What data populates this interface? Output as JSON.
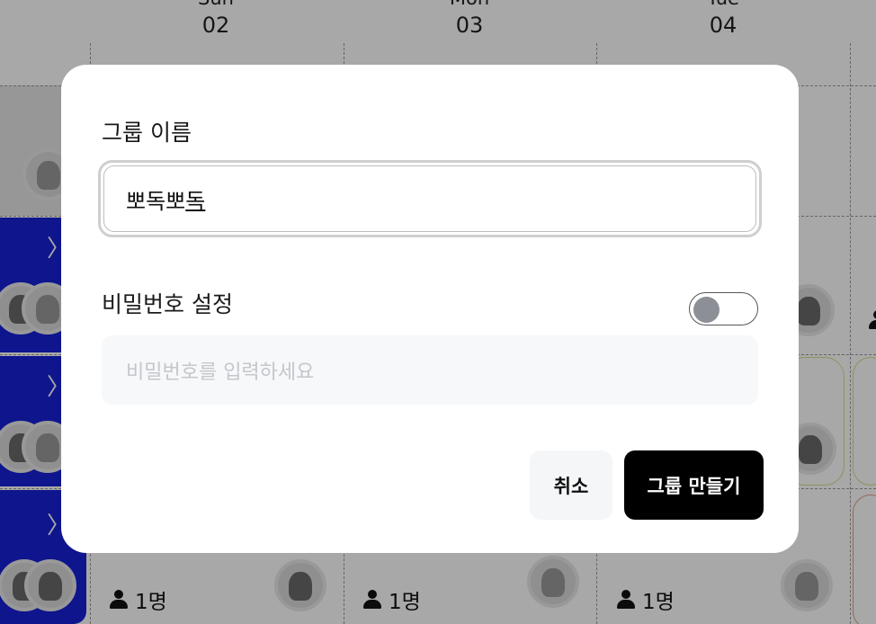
{
  "calendar": {
    "days": [
      {
        "dow": "Sun",
        "num": "02"
      },
      {
        "dow": "Mon",
        "num": "03"
      },
      {
        "dow": "Tue",
        "num": "04"
      }
    ],
    "counts": [
      "1명",
      "1명",
      "1명"
    ]
  },
  "modal": {
    "group_name_label": "그룹 이름",
    "group_name_value_plain": "뽀독뽀",
    "group_name_value_composing": "독",
    "password_label": "비밀번호 설정",
    "password_toggle_on": false,
    "password_placeholder": "비밀번호를 입력하세요",
    "cancel_label": "취소",
    "create_label": "그룹 만들기"
  },
  "icons": {
    "chevron": "chevron-right-icon",
    "person": "person-icon"
  }
}
